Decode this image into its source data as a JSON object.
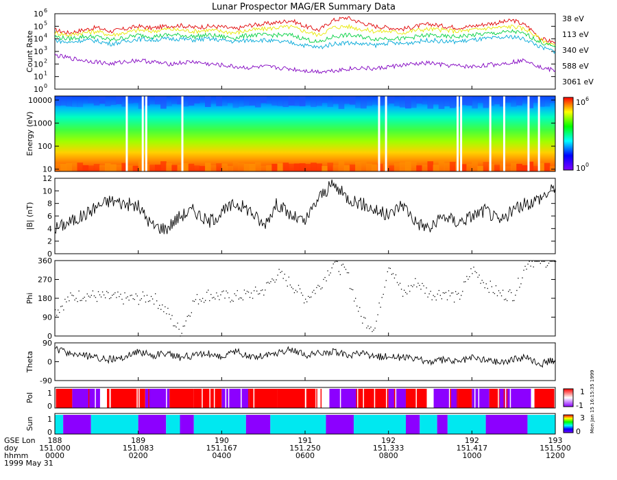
{
  "title": "Lunar Prospector MAG/ER Summary Data",
  "colors": {
    "38 eV": "#e00000",
    "113 eV": "#e8e800",
    "340 eV": "#00d040",
    "588 eV": "#00a8d8",
    "3061 eV": "#8000c0",
    "pol_pos": "#ff0000",
    "pol_neg": "#8c00ff",
    "sun_a": "#00e8f0",
    "sun_b": "#8c00ff"
  },
  "stamp": "Mon Jan 15 16:15:35 1999",
  "chart_data": [
    {
      "type": "line",
      "id": "count_rate",
      "ylabel": "Count Rate",
      "yscale": "log",
      "ylim": [
        1,
        1000000
      ],
      "ytick_labels": [
        "10",
        "10",
        "10",
        "10",
        "10",
        "10",
        "10"
      ],
      "ytick_exps": [
        "0",
        "1",
        "2",
        "3",
        "4",
        "5",
        "6"
      ],
      "x": [
        0,
        20,
        40,
        60,
        80,
        100,
        120,
        140,
        160,
        180,
        200,
        220,
        240,
        260,
        280,
        300,
        320,
        340,
        360,
        380,
        400,
        420,
        440,
        460,
        480,
        500,
        520,
        540,
        560,
        580,
        600,
        620,
        640,
        660,
        680,
        700,
        720
      ],
      "series": [
        {
          "name": "38 eV",
          "values": [
            50000,
            30000,
            50000,
            80000,
            40000,
            60000,
            100000,
            70000,
            100000,
            120000,
            80000,
            100000,
            90000,
            60000,
            120000,
            150000,
            200000,
            300000,
            100000,
            50000,
            300000,
            500000,
            200000,
            100000,
            80000,
            60000,
            100000,
            150000,
            100000,
            80000,
            100000,
            150000,
            200000,
            300000,
            100000,
            10000,
            5000
          ]
        },
        {
          "name": "113 eV",
          "values": [
            30000,
            20000,
            30000,
            40000,
            20000,
            30000,
            50000,
            40000,
            60000,
            50000,
            40000,
            50000,
            40000,
            30000,
            50000,
            60000,
            80000,
            90000,
            40000,
            20000,
            80000,
            100000,
            60000,
            40000,
            40000,
            30000,
            50000,
            60000,
            50000,
            40000,
            50000,
            70000,
            80000,
            100000,
            50000,
            8000,
            3000
          ]
        },
        {
          "name": "340 eV",
          "values": [
            15000,
            10000,
            15000,
            15000,
            8000,
            12000,
            20000,
            15000,
            20000,
            20000,
            15000,
            20000,
            15000,
            12000,
            20000,
            20000,
            20000,
            20000,
            10000,
            5000,
            15000,
            20000,
            15000,
            10000,
            12000,
            10000,
            15000,
            20000,
            15000,
            15000,
            20000,
            25000,
            30000,
            40000,
            20000,
            5000,
            2000
          ]
        },
        {
          "name": "588 eV",
          "values": [
            8000,
            5000,
            8000,
            7000,
            4000,
            6000,
            10000,
            8000,
            10000,
            10000,
            8000,
            10000,
            8000,
            6000,
            8000,
            8000,
            6000,
            5000,
            3000,
            2000,
            4000,
            5000,
            4000,
            3000,
            5000,
            4000,
            6000,
            8000,
            6000,
            6000,
            8000,
            10000,
            12000,
            15000,
            8000,
            2000,
            1000
          ]
        },
        {
          "name": "3061 eV",
          "values": [
            500,
            300,
            200,
            150,
            100,
            150,
            200,
            150,
            100,
            120,
            150,
            100,
            80,
            60,
            50,
            60,
            50,
            40,
            30,
            25,
            30,
            40,
            50,
            40,
            60,
            80,
            100,
            120,
            80,
            70,
            60,
            80,
            100,
            150,
            200,
            50,
            30
          ]
        }
      ]
    },
    {
      "type": "heatmap",
      "id": "spectrogram",
      "ylabel": "Energy (eV)",
      "yscale": "log",
      "ylim": [
        8,
        15000
      ],
      "ytick_labels": [
        "10",
        "100",
        "1000",
        "10000"
      ],
      "colorbar": {
        "min_label": "10",
        "min_exp": "0",
        "max_label": "10",
        "max_exp": "6"
      },
      "gaps": [
        102,
        125,
        130,
        182,
        465,
        475,
        578,
        583,
        625,
        645,
        680,
        695
      ]
    },
    {
      "type": "line",
      "id": "bmag",
      "ylabel": "|B| (nT)",
      "ylim": [
        0,
        12
      ],
      "ytick_labels": [
        "0",
        "2",
        "4",
        "6",
        "8",
        "10",
        "12"
      ],
      "x": [
        0,
        20,
        40,
        60,
        80,
        100,
        120,
        140,
        160,
        180,
        200,
        220,
        240,
        260,
        280,
        300,
        320,
        340,
        360,
        380,
        400,
        420,
        440,
        460,
        480,
        500,
        520,
        540,
        560,
        580,
        600,
        620,
        640,
        660,
        680,
        700,
        720
      ],
      "values": [
        4,
        5,
        6,
        7.5,
        8.5,
        8,
        7.5,
        4.5,
        4,
        6,
        7,
        5,
        6.5,
        8,
        7,
        4.5,
        8,
        6,
        5,
        9,
        11,
        9,
        8,
        7,
        6,
        8,
        5,
        4,
        6,
        5,
        6,
        7,
        5,
        7,
        8,
        9,
        10.5
      ]
    },
    {
      "type": "scatter",
      "id": "phi",
      "ylabel": "Phi",
      "ylim": [
        0,
        360
      ],
      "ytick_labels": [
        "0",
        "90",
        "180",
        "270",
        "360"
      ],
      "x": [
        0,
        20,
        40,
        60,
        80,
        100,
        120,
        140,
        160,
        180,
        200,
        220,
        240,
        260,
        280,
        300,
        320,
        340,
        360,
        380,
        400,
        420,
        440,
        460,
        480,
        500,
        520,
        540,
        560,
        580,
        600,
        620,
        640,
        660,
        680,
        700,
        720
      ],
      "values": [
        120,
        180,
        200,
        190,
        185,
        180,
        180,
        190,
        120,
        20,
        170,
        200,
        190,
        190,
        200,
        220,
        300,
        250,
        180,
        240,
        350,
        300,
        90,
        40,
        350,
        200,
        260,
        200,
        210,
        180,
        320,
        250,
        200,
        200,
        360,
        360,
        360
      ]
    },
    {
      "type": "line",
      "id": "theta",
      "ylabel": "Theta",
      "ylim": [
        -90,
        90
      ],
      "ytick_labels": [
        "-90",
        "0",
        "90"
      ],
      "x": [
        0,
        20,
        40,
        60,
        80,
        100,
        120,
        140,
        160,
        180,
        200,
        220,
        240,
        260,
        280,
        300,
        320,
        340,
        360,
        380,
        400,
        420,
        440,
        460,
        480,
        500,
        520,
        540,
        560,
        580,
        600,
        620,
        640,
        660,
        680,
        700,
        720
      ],
      "values": [
        60,
        40,
        30,
        20,
        10,
        20,
        50,
        30,
        40,
        20,
        30,
        40,
        20,
        50,
        20,
        30,
        40,
        60,
        30,
        40,
        50,
        30,
        40,
        20,
        30,
        20,
        10,
        0,
        10,
        0,
        20,
        10,
        0,
        10,
        20,
        -10,
        10
      ]
    },
    {
      "type": "table",
      "id": "pol",
      "ylabel": "Pol",
      "ytick_labels": [
        "0",
        "1"
      ],
      "colorbar": {
        "max_label": "1",
        "min_label": "-1"
      },
      "segments": [
        {
          "start": 0,
          "end": 25,
          "value": 1
        },
        {
          "start": 25,
          "end": 65,
          "value": -1
        },
        {
          "start": 65,
          "end": 75,
          "value": 0
        },
        {
          "start": 75,
          "end": 130,
          "value": 1
        },
        {
          "start": 130,
          "end": 165,
          "value": -1
        },
        {
          "start": 165,
          "end": 200,
          "value": 1
        },
        {
          "start": 200,
          "end": 240,
          "value": 1
        },
        {
          "start": 240,
          "end": 280,
          "value": -1
        },
        {
          "start": 280,
          "end": 320,
          "value": 1
        },
        {
          "start": 320,
          "end": 375,
          "value": 1
        },
        {
          "start": 375,
          "end": 395,
          "value": 0
        },
        {
          "start": 395,
          "end": 435,
          "value": -1
        },
        {
          "start": 435,
          "end": 480,
          "value": 1
        },
        {
          "start": 480,
          "end": 505,
          "value": -1
        },
        {
          "start": 505,
          "end": 535,
          "value": 1
        },
        {
          "start": 535,
          "end": 545,
          "value": 0
        },
        {
          "start": 545,
          "end": 580,
          "value": -1
        },
        {
          "start": 580,
          "end": 600,
          "value": 1
        },
        {
          "start": 600,
          "end": 625,
          "value": -1
        },
        {
          "start": 625,
          "end": 640,
          "value": 1
        },
        {
          "start": 640,
          "end": 685,
          "value": -1
        },
        {
          "start": 685,
          "end": 690,
          "value": 0
        },
        {
          "start": 690,
          "end": 720,
          "value": 1
        }
      ]
    },
    {
      "type": "table",
      "id": "sun",
      "ylabel": "Sun",
      "ytick_labels": [
        "0",
        "1"
      ],
      "colorbar": {
        "max_label": "3",
        "min_label": "0"
      },
      "segments": [
        {
          "start": 0,
          "end": 12,
          "value": 1
        },
        {
          "start": 12,
          "end": 52,
          "value": 0
        },
        {
          "start": 52,
          "end": 120,
          "value": 1
        },
        {
          "start": 120,
          "end": 160,
          "value": 0
        },
        {
          "start": 160,
          "end": 180,
          "value": 1
        },
        {
          "start": 180,
          "end": 200,
          "value": 0
        },
        {
          "start": 200,
          "end": 275,
          "value": 1
        },
        {
          "start": 275,
          "end": 310,
          "value": 0
        },
        {
          "start": 310,
          "end": 390,
          "value": 1
        },
        {
          "start": 390,
          "end": 430,
          "value": 0
        },
        {
          "start": 430,
          "end": 505,
          "value": 1
        },
        {
          "start": 505,
          "end": 525,
          "value": 0
        },
        {
          "start": 525,
          "end": 550,
          "value": 1
        },
        {
          "start": 550,
          "end": 565,
          "value": 0
        },
        {
          "start": 565,
          "end": 620,
          "value": 1
        },
        {
          "start": 620,
          "end": 680,
          "value": 0
        },
        {
          "start": 680,
          "end": 720,
          "value": 1
        }
      ]
    }
  ],
  "x_axis": {
    "row_labels": [
      "GSE Lon",
      "doy",
      "hhmm",
      "1999 May 31"
    ],
    "ticks": [
      {
        "lon": "188",
        "doy": "151.000",
        "hhmm": "0000"
      },
      {
        "lon": "189",
        "doy": "151.083",
        "hhmm": "0200"
      },
      {
        "lon": "190",
        "doy": "151.167",
        "hhmm": "0400"
      },
      {
        "lon": "191",
        "doy": "151.250",
        "hhmm": "0600"
      },
      {
        "lon": "192",
        "doy": "151.333",
        "hhmm": "0800"
      },
      {
        "lon": "192",
        "doy": "151.417",
        "hhmm": "1000"
      },
      {
        "lon": "193",
        "doy": "151.500",
        "hhmm": "1200"
      }
    ]
  }
}
